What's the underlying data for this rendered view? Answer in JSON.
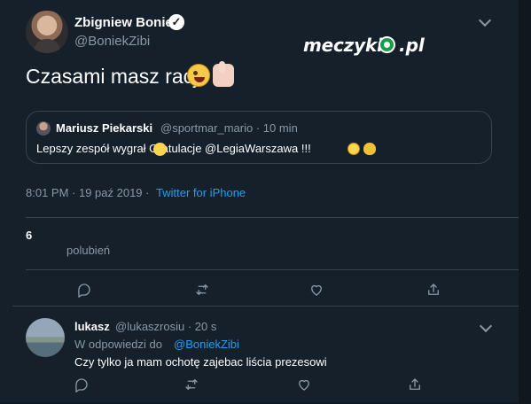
{
  "main_tweet": {
    "author_name": "Zbigniew Boniek",
    "author_handle": "@BoniekZibi",
    "text": "Czasami masz racje",
    "timestamp": "8:01 PM · 19 paź 2019 ·",
    "source": "Twitter for iPhone",
    "likes_count": "6",
    "likes_label": "polubień",
    "emoji": [
      "crazy-face",
      "thumbs-up"
    ]
  },
  "brand": {
    "name": "meczyki",
    "suffix": "pl"
  },
  "quote_tweet": {
    "author_name": "Mariusz Piekarski",
    "author_handle": "@sportmar_mario · 10 min",
    "text": "Lepszy zespół wygrał  Gratulacje @LegiaWarszawa !!!",
    "emoji": [
      "clapping-hands",
      "winking-face",
      "flexed-biceps"
    ]
  },
  "reply_tweet": {
    "author_name": "lukasz",
    "author_handle": "@lukaszrosiu · 20 s",
    "reply_prefix": "W odpowiedzi do",
    "reply_to": "@BoniekZibi",
    "text": "Czy tylko ja mam ochotę zajebac liścia prezesowi"
  },
  "actions": [
    "reply-icon",
    "retweet-icon",
    "like-icon",
    "share-icon"
  ],
  "colors": {
    "background": "#15202b",
    "text": "#ffffff",
    "muted": "#8899a6",
    "link": "#1da1f2",
    "border": "#38444d"
  }
}
